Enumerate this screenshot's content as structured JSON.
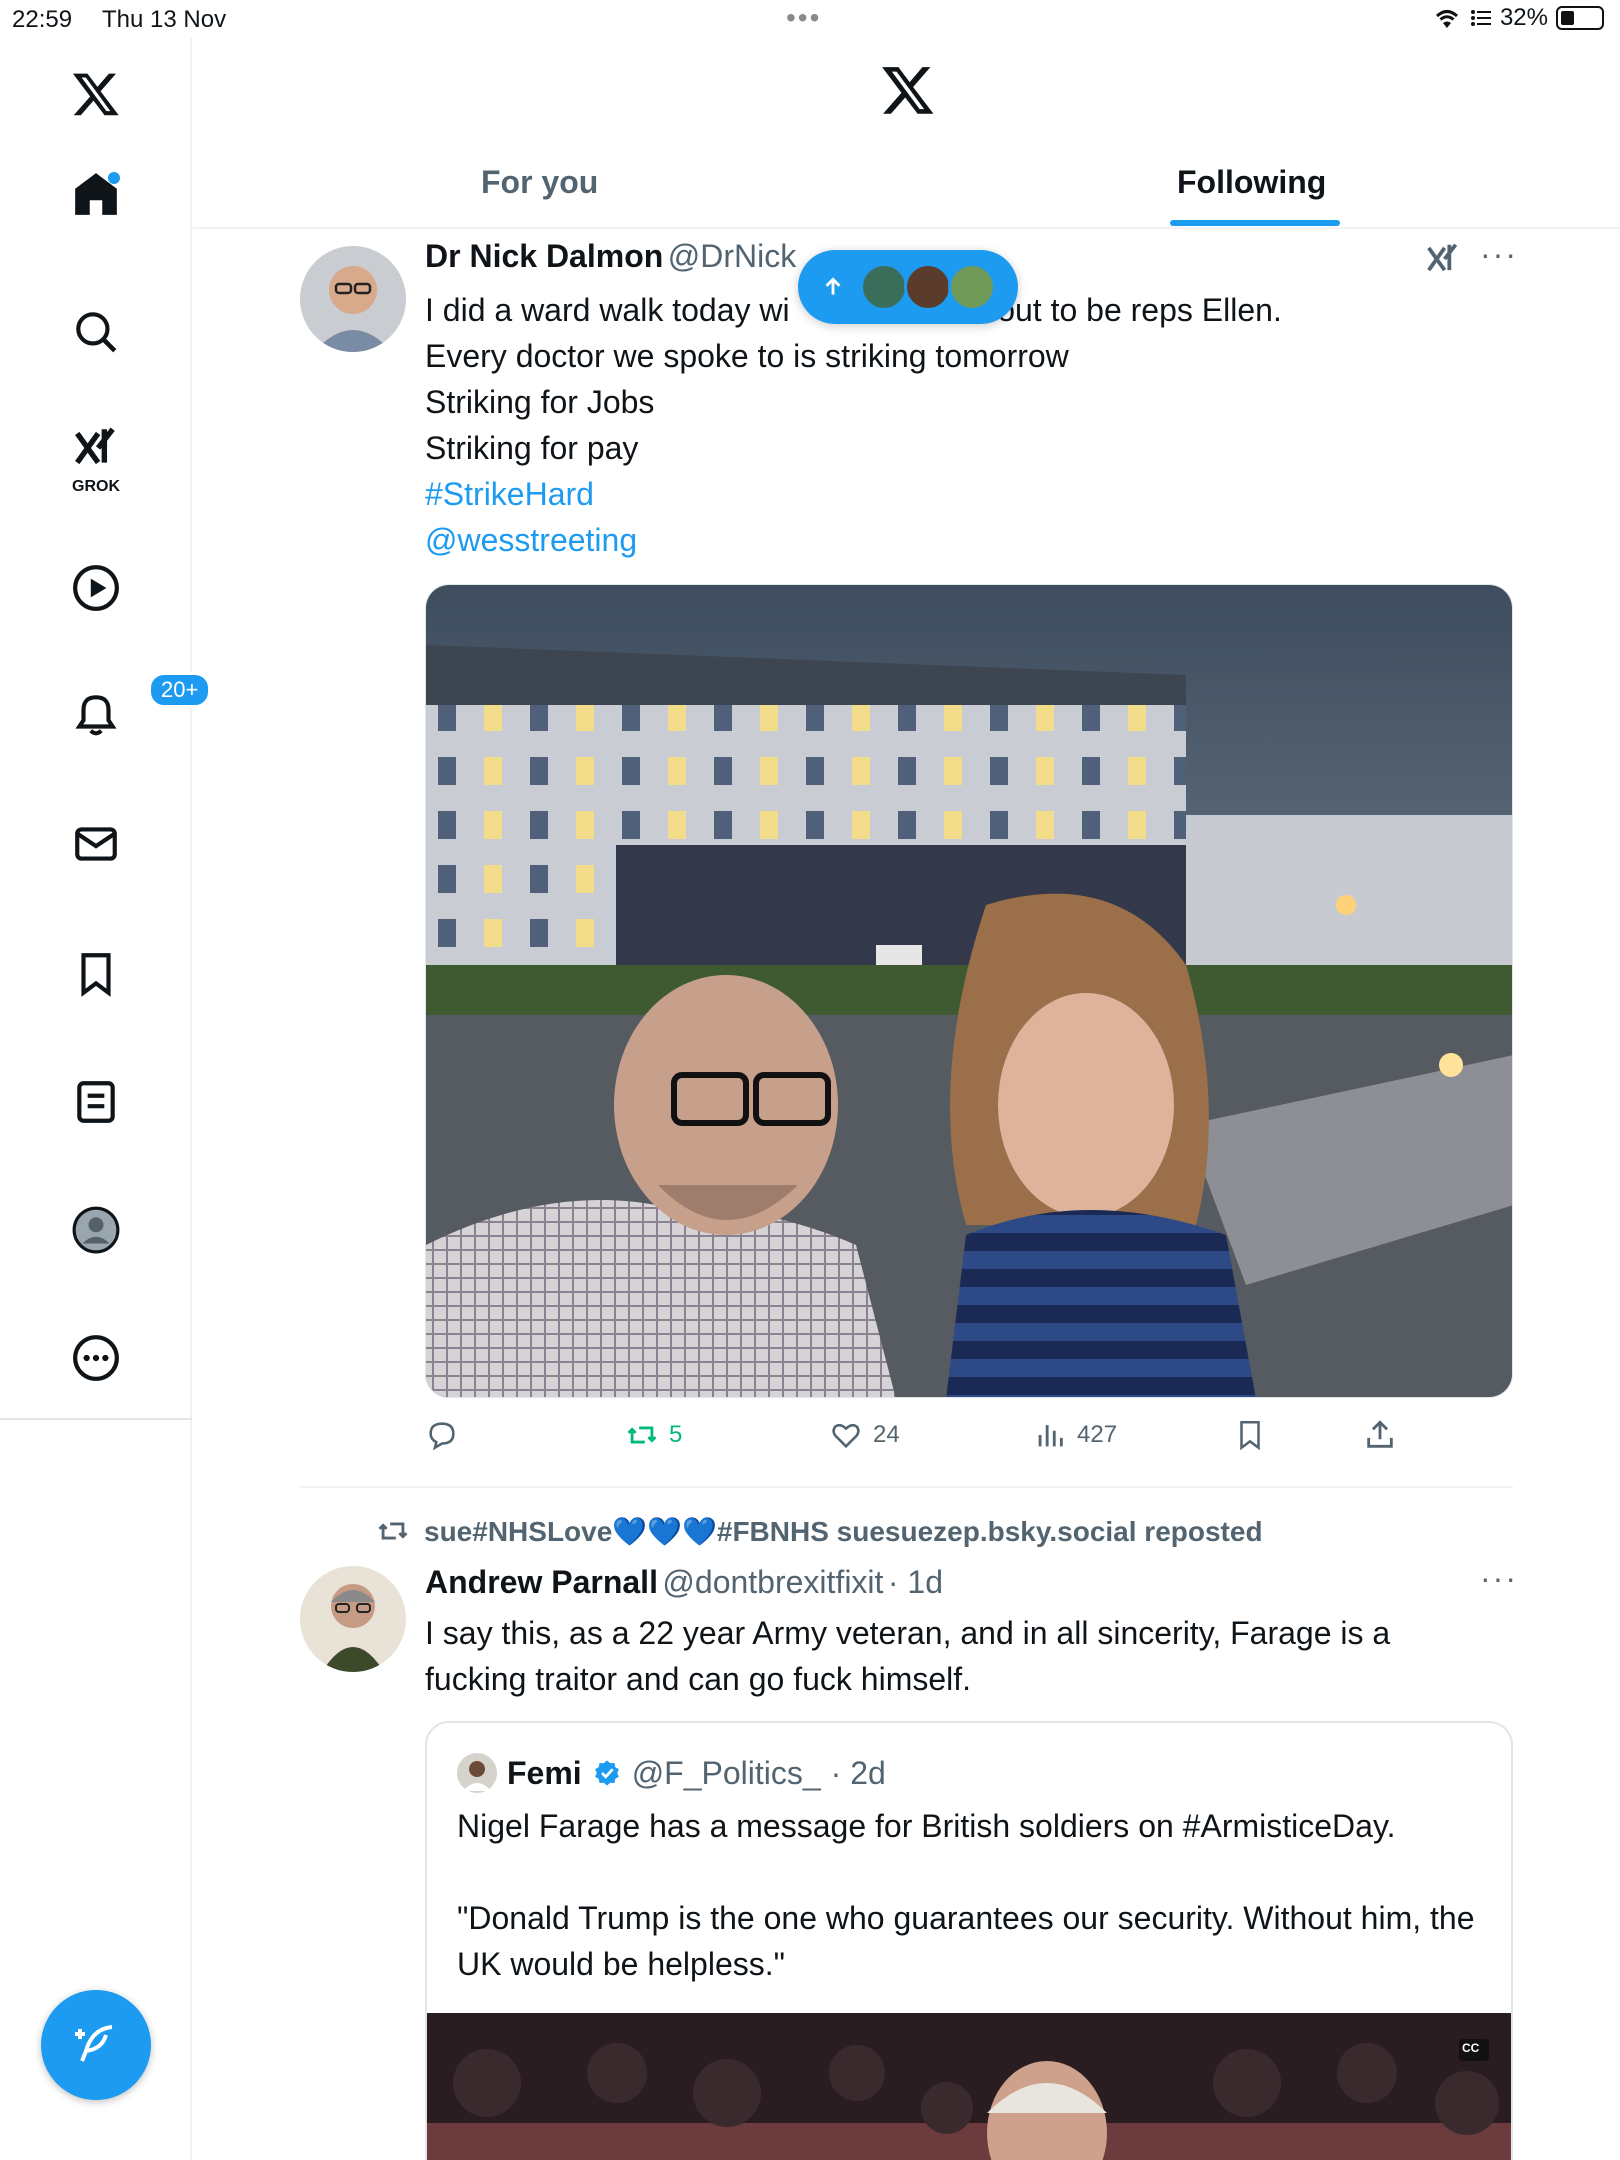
{
  "status_bar": {
    "time": "22:59",
    "date": "Thu 13 Nov",
    "multitask": "•••",
    "battery_percent": "32%",
    "battery_level": 0.32
  },
  "sidebar": {
    "grok_label": "GROK",
    "notifications_badge": "20+",
    "items": [
      "x-logo",
      "home",
      "search",
      "grok",
      "video",
      "notifications",
      "messages",
      "bookmarks",
      "lists",
      "profile",
      "more"
    ]
  },
  "header": {
    "tabs": [
      {
        "label": "For you",
        "active": false
      },
      {
        "label": "Following",
        "active": true
      }
    ]
  },
  "posts": [
    {
      "name": "Dr Nick Dalmon",
      "handle": "@DrNick",
      "lines": [
        "I did a ward walk today wi",
        "about to be reps Ellen.",
        "Every doctor we spoke to is striking tomorrow",
        "Striking for Jobs",
        "Striking for pay"
      ],
      "hashtag": "#StrikeHard",
      "mention": "@wesstreeting",
      "actions": {
        "replies": "",
        "reposts": "5",
        "likes": "24",
        "views": "427"
      }
    },
    {
      "repost_by": "sue#NHSLove💙💙💙#FBNHS suesuezep.bsky.social reposted",
      "name": "Andrew Parnall",
      "handle": "@dontbrexitfixit",
      "time": "· 1d",
      "text": "I say this, as a 22 year Army veteran, and in all sincerity, Farage is a fucking traitor and can go fuck himself.",
      "quote": {
        "name": "Femi",
        "handle": "@F_Politics_",
        "time": "· 2d",
        "text1": "Nigel Farage has a message for British soldiers on #ArmisticeDay.",
        "text2": "\"Donald Trump is the one who guarantees our security. Without him, the UK would be helpless.\"",
        "media_badge": "CC"
      }
    }
  ],
  "colors": {
    "accent": "#1d9bf0",
    "repost_green": "#00ba7c",
    "muted": "#536471",
    "text": "#0f1419"
  }
}
